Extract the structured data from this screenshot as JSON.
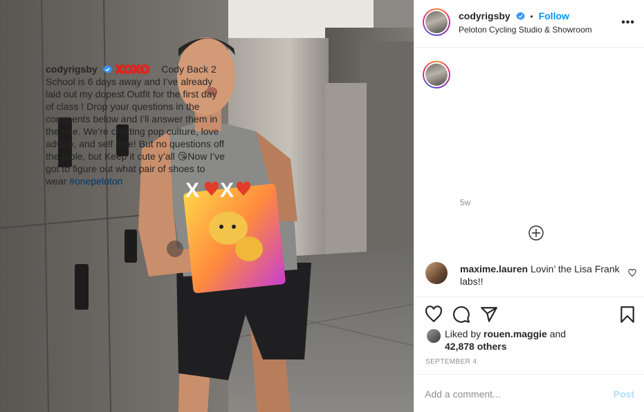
{
  "post": {
    "username": "codyrigsby",
    "verified": true,
    "separator": "•",
    "follow_label": "Follow",
    "location": "Peloton Cycling Studio & Showroom",
    "more_label": "•••"
  },
  "caption": {
    "username": "codyrigsby",
    "emoji_word": "XOXO",
    "text_1": " Cody Back 2 School is 6 days away and I’ve already laid out my dopest Outfit for the first day of class ! Drop your questions in the comments below and I’ll answer them in the ride. We’re chatting pop culture, love advice, and self love! But no questions off the table, but Keep it cute y’all ",
    "emoji_kiss": "😘",
    "text_2": "Now I’ve got to figure out what pair of shoes to wear ",
    "hashtag": "#onepeloton",
    "age": "5w"
  },
  "comments": [
    {
      "username": "maxime.lauren",
      "text": " Lovin’ the Lisa Frank labs!!"
    }
  ],
  "likes": {
    "prefix": "Liked by ",
    "user": "rouen.maggie",
    "and": " and",
    "others": "42,878 others"
  },
  "date": "SEPTEMBER 4",
  "add_comment": {
    "placeholder": "Add a comment...",
    "post_label": "Post"
  },
  "photo": {
    "shirt_text": "XOXO",
    "colors": {
      "locker": "#6f6c68",
      "wall": "#b9b5ae",
      "shirt": "#8a8a88",
      "shorts": "#1f1f21",
      "skin": "#c98f6c"
    }
  },
  "colors": {
    "accent": "#0095f6",
    "hashtag": "#00376b",
    "muted": "#8e8e8e",
    "border": "#efefef",
    "heart": "#ed4956"
  }
}
